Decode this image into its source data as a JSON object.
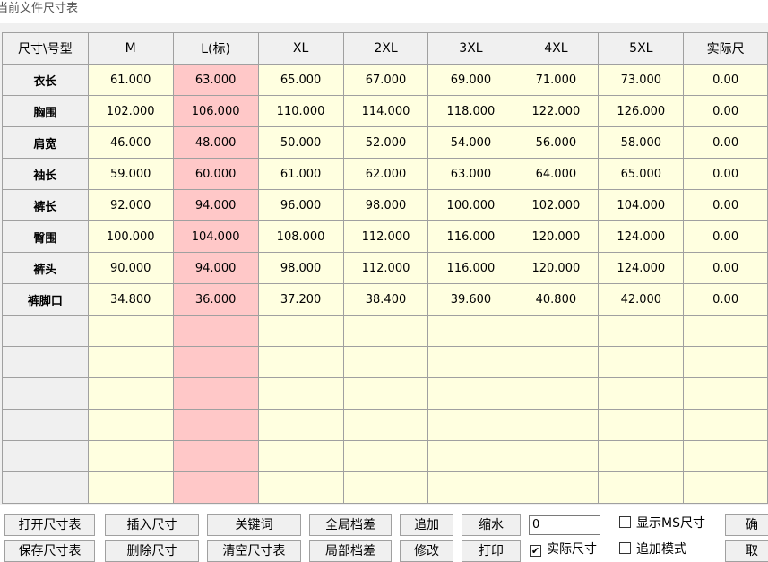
{
  "window": {
    "title": "当前文件尺寸表"
  },
  "grid": {
    "corner_header": "尺寸\\号型",
    "columns": [
      "M",
      "L(标)",
      "XL",
      "2XL",
      "3XL",
      "4XL",
      "5XL",
      "实际尺"
    ],
    "rows": [
      {
        "label": "衣长",
        "values": [
          "61.000",
          "63.000",
          "65.000",
          "67.000",
          "69.000",
          "71.000",
          "73.000",
          "0.00"
        ]
      },
      {
        "label": "胸围",
        "values": [
          "102.000",
          "106.000",
          "110.000",
          "114.000",
          "118.000",
          "122.000",
          "126.000",
          "0.00"
        ]
      },
      {
        "label": "肩宽",
        "values": [
          "46.000",
          "48.000",
          "50.000",
          "52.000",
          "54.000",
          "56.000",
          "58.000",
          "0.00"
        ]
      },
      {
        "label": "袖长",
        "values": [
          "59.000",
          "60.000",
          "61.000",
          "62.000",
          "63.000",
          "64.000",
          "65.000",
          "0.00"
        ]
      },
      {
        "label": "裤长",
        "values": [
          "92.000",
          "94.000",
          "96.000",
          "98.000",
          "100.000",
          "102.000",
          "104.000",
          "0.00"
        ]
      },
      {
        "label": "臀围",
        "values": [
          "100.000",
          "104.000",
          "108.000",
          "112.000",
          "116.000",
          "120.000",
          "124.000",
          "0.00"
        ]
      },
      {
        "label": "裤头",
        "values": [
          "90.000",
          "94.000",
          "98.000",
          "112.000",
          "116.000",
          "120.000",
          "124.000",
          "0.00"
        ]
      },
      {
        "label": "裤脚口",
        "values": [
          "34.800",
          "36.000",
          "37.200",
          "38.400",
          "39.600",
          "40.800",
          "42.000",
          "0.00"
        ]
      }
    ]
  },
  "buttons": {
    "open_size_table": "打开尺寸表",
    "save_size_table": "保存尺寸表",
    "insert_size": "插入尺寸",
    "delete_size": "删除尺寸",
    "keyword": "关键词",
    "clear_size_table": "清空尺寸表",
    "global_grade": "全局档差",
    "local_grade": "局部档差",
    "append": "追加",
    "modify": "修改",
    "shrink": "缩水",
    "print": "打印",
    "confirm": "确",
    "cancel": "取"
  },
  "input": {
    "value": "0"
  },
  "checkboxes": {
    "show_ms_size": {
      "label": "显示MS尺寸",
      "checked": false
    },
    "actual_size": {
      "label": "实际尺寸",
      "checked": true
    },
    "append_mode": {
      "label": "追加模式",
      "checked": false
    }
  },
  "colors": {
    "base_column": "#ffc8c8",
    "cell_background": "#ffffe0",
    "header_background": "#f0f0f0"
  }
}
